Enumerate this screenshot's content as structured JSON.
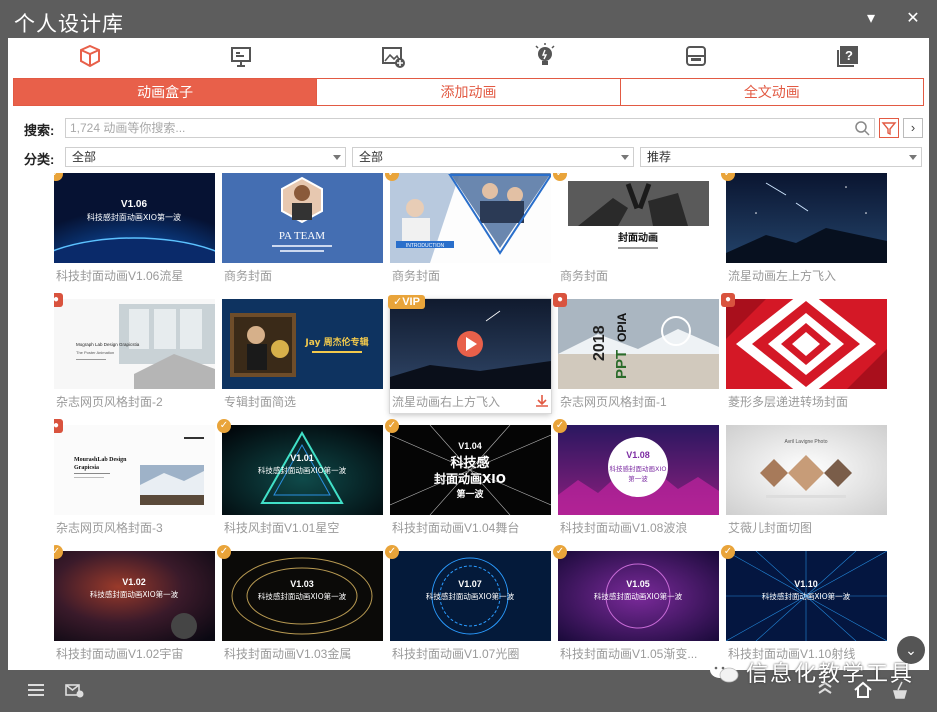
{
  "window": {
    "title": "个人设计库",
    "minimize_glyph": "▾",
    "close_glyph": "✕"
  },
  "toolbar": {
    "icons": [
      "box-icon",
      "presentation-icon",
      "image-add-icon",
      "lightbulb-icon",
      "storage-icon",
      "help-icon"
    ]
  },
  "tabs": [
    {
      "label": "动画盒子",
      "active": true
    },
    {
      "label": "添加动画",
      "active": false
    },
    {
      "label": "全文动画",
      "active": false
    }
  ],
  "search": {
    "label": "搜索:",
    "placeholder": "1,724 动画等你搜索..."
  },
  "category": {
    "label": "分类:",
    "selects": [
      "全部",
      "全部",
      "推荐"
    ]
  },
  "colors": {
    "accent": "#e8604a",
    "badge_gold": "#e9a43a",
    "badge_red": "#d9533e"
  },
  "grid": {
    "items": [
      {
        "caption": "科技封面动画V1.06流星",
        "badge": "check",
        "thumb": "tech-v106",
        "tag": "V1.06"
      },
      {
        "caption": "商务封面",
        "badge": "",
        "thumb": "pa-team",
        "tag": "PA TEAM"
      },
      {
        "caption": "商务封面",
        "badge": "check",
        "thumb": "business-intro",
        "tag": "INTRODUCTION"
      },
      {
        "caption": "商务封面",
        "badge": "check",
        "thumb": "cover-anim",
        "tag": "封面动画"
      },
      {
        "caption": "流星动画左上方飞入",
        "badge": "check",
        "thumb": "meteor-left",
        "tag": ""
      },
      {
        "caption": "杂志网页风格封面-2",
        "badge": "red",
        "thumb": "magazine-2",
        "tag": "Mograph Lab Design Grapicstia"
      },
      {
        "caption": "专辑封面简选",
        "badge": "",
        "thumb": "album",
        "tag": "Jay 周杰伦专辑"
      },
      {
        "caption": "流星动画右上方飞入",
        "badge": "vip",
        "thumb": "meteor-right",
        "tag": "",
        "selected": true
      },
      {
        "caption": "杂志网页风格封面-1",
        "badge": "red",
        "thumb": "magazine-1",
        "tag": "2018 PPTOPIA"
      },
      {
        "caption": "菱形多层递进转场封面",
        "badge": "red",
        "thumb": "diamond",
        "tag": ""
      },
      {
        "caption": "杂志网页风格封面-3",
        "badge": "red",
        "thumb": "magazine-3",
        "tag": "MourashLab Design Grapicsia"
      },
      {
        "caption": "科技风封面V1.01星空",
        "badge": "check",
        "thumb": "tech-v101",
        "tag": "V1.01"
      },
      {
        "caption": "科技封面动画V1.04舞台",
        "badge": "check",
        "thumb": "tech-v104",
        "tag": "V1.04"
      },
      {
        "caption": "科技封面动画V1.08波浪",
        "badge": "check",
        "thumb": "tech-v108",
        "tag": "V1.08"
      },
      {
        "caption": "艾薇儿封面切图",
        "badge": "",
        "thumb": "avril",
        "tag": ""
      },
      {
        "caption": "科技封面动画V1.02宇宙",
        "badge": "check",
        "thumb": "tech-v102",
        "tag": "V1.02"
      },
      {
        "caption": "科技封面动画V1.03金属",
        "badge": "check",
        "thumb": "tech-v103",
        "tag": "V1.03"
      },
      {
        "caption": "科技封面动画V1.07光圈",
        "badge": "check",
        "thumb": "tech-v107",
        "tag": "V1.07"
      },
      {
        "caption": "科技封面动画V1.05渐变...",
        "badge": "check",
        "thumb": "tech-v105",
        "tag": "V1.05"
      },
      {
        "caption": "科技封面动画V1.10射线",
        "badge": "check",
        "thumb": "tech-v110",
        "tag": "V1.10"
      }
    ],
    "vip_label": "VIP",
    "tech_subtitle": "科技感封面动画XIO第一波"
  },
  "footer": {
    "watermark": "信息化教学工具"
  }
}
